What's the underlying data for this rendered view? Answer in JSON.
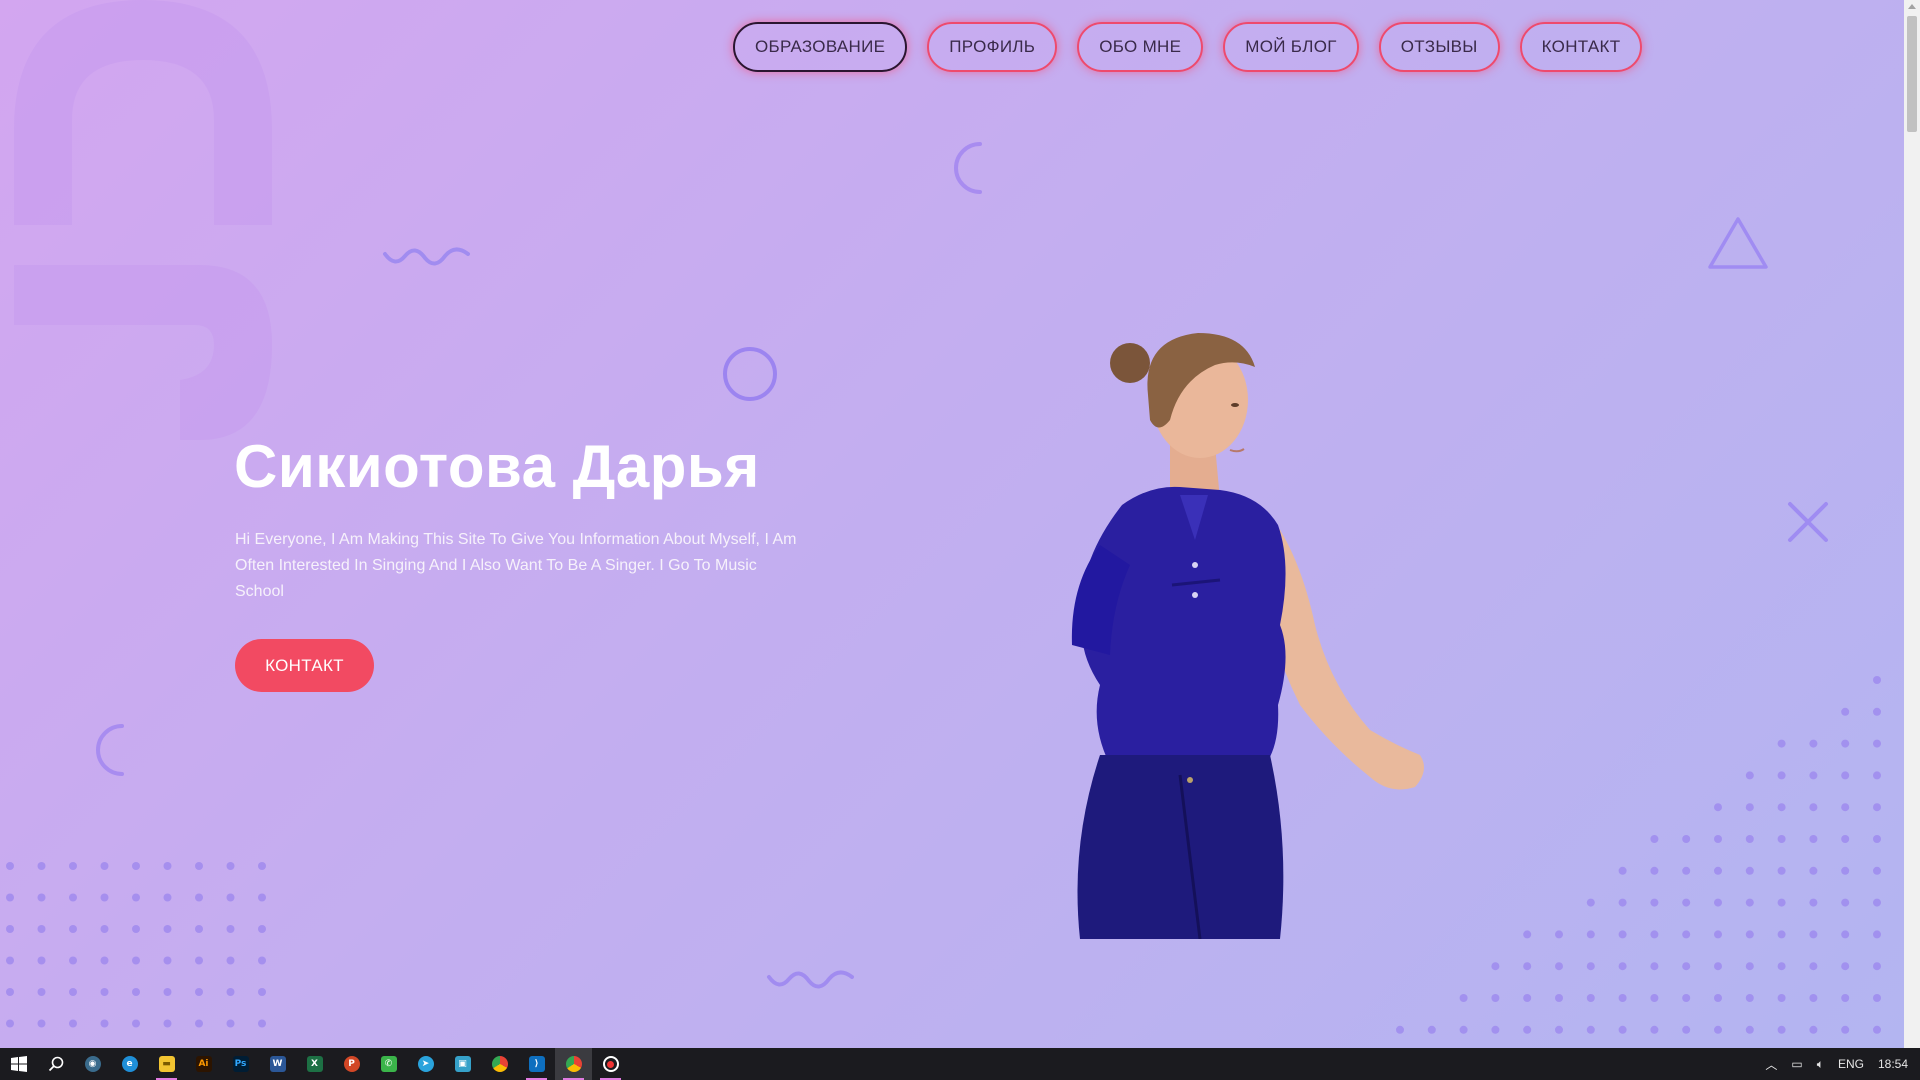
{
  "nav": {
    "items": [
      {
        "label": "ОБРАЗОВАНИЕ",
        "active": true
      },
      {
        "label": "ПРОФИЛЬ",
        "active": false
      },
      {
        "label": "ОБО МНЕ",
        "active": false
      },
      {
        "label": "МОЙ БЛОГ",
        "active": false
      },
      {
        "label": "ОТЗЫВЫ",
        "active": false
      },
      {
        "label": "КОНТАКТ",
        "active": false
      }
    ]
  },
  "hero": {
    "title": "Сикиотова Дарья",
    "text": "Hi Everyone, I Am Making This Site To Give You Information About Myself, I Am Often Interested In Singing And I Also Want To Be A Singer. I Go To Music School",
    "cta_label": "КОНТАКТ",
    "image_icon": "person-portrait"
  },
  "colors": {
    "accent": "#f24a62",
    "nav_border": "#ee4a6d",
    "background_start": "#d3a6f0",
    "background_end": "#b3b5f1",
    "decor": "#9b86ee"
  },
  "taskbar": {
    "icons": [
      "windows-start-icon",
      "search-icon",
      "davinci-icon",
      "edge-icon",
      "file-explorer-icon",
      "illustrator-icon",
      "photoshop-icon",
      "word-icon",
      "excel-icon",
      "powerpoint-icon",
      "whatsapp-icon",
      "telegram-icon",
      "app-icon",
      "chrome-icon",
      "vscode-icon",
      "chrome-icon",
      "record-icon"
    ],
    "tray": {
      "language": "ENG",
      "time": "18:54"
    }
  }
}
